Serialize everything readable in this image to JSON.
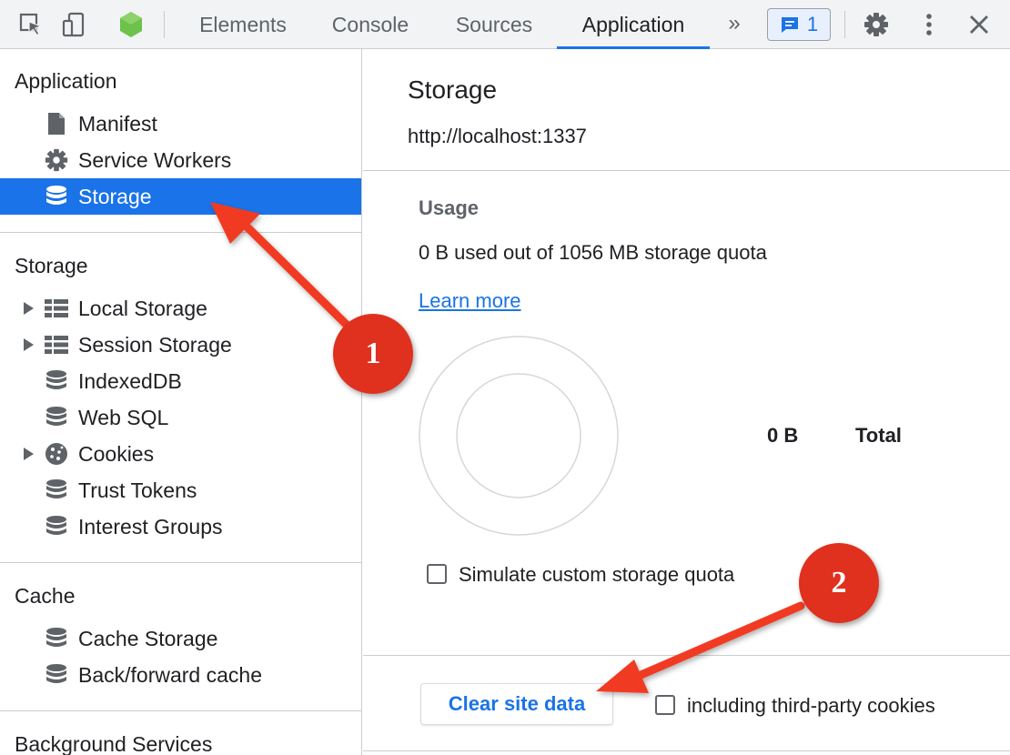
{
  "toolbar": {
    "tabs": [
      "Elements",
      "Console",
      "Sources",
      "Application"
    ],
    "active_tab": "Application",
    "more_tabs_label": "»",
    "issues_count": "1"
  },
  "sidebar": {
    "application_title": "Application",
    "application_items": [
      "Manifest",
      "Service Workers",
      "Storage"
    ],
    "selected_item": "Storage",
    "storage_title": "Storage",
    "storage_items": [
      "Local Storage",
      "Session Storage",
      "IndexedDB",
      "Web SQL",
      "Cookies",
      "Trust Tokens",
      "Interest Groups"
    ],
    "cache_title": "Cache",
    "cache_items": [
      "Cache Storage",
      "Back/forward cache"
    ],
    "background_title": "Background Services"
  },
  "main": {
    "title": "Storage",
    "origin": "http://localhost:1337",
    "usage_title": "Usage",
    "usage_text": "0 B used out of 1056 MB storage quota",
    "learn_more": "Learn more",
    "legend_value": "0 B",
    "legend_label": "Total",
    "simulate_quota_label": "Simulate custom storage quota",
    "clear_button": "Clear site data",
    "third_party_label": "including third-party cookies"
  },
  "annotations": {
    "callout_1": "1",
    "callout_2": "2",
    "arrow_color": "#f03b22",
    "callout_color": "#e0301e"
  },
  "colors": {
    "accent": "#1a73e8",
    "selection": "#1a73e8",
    "toolbar_bg": "#f1f3f4"
  }
}
